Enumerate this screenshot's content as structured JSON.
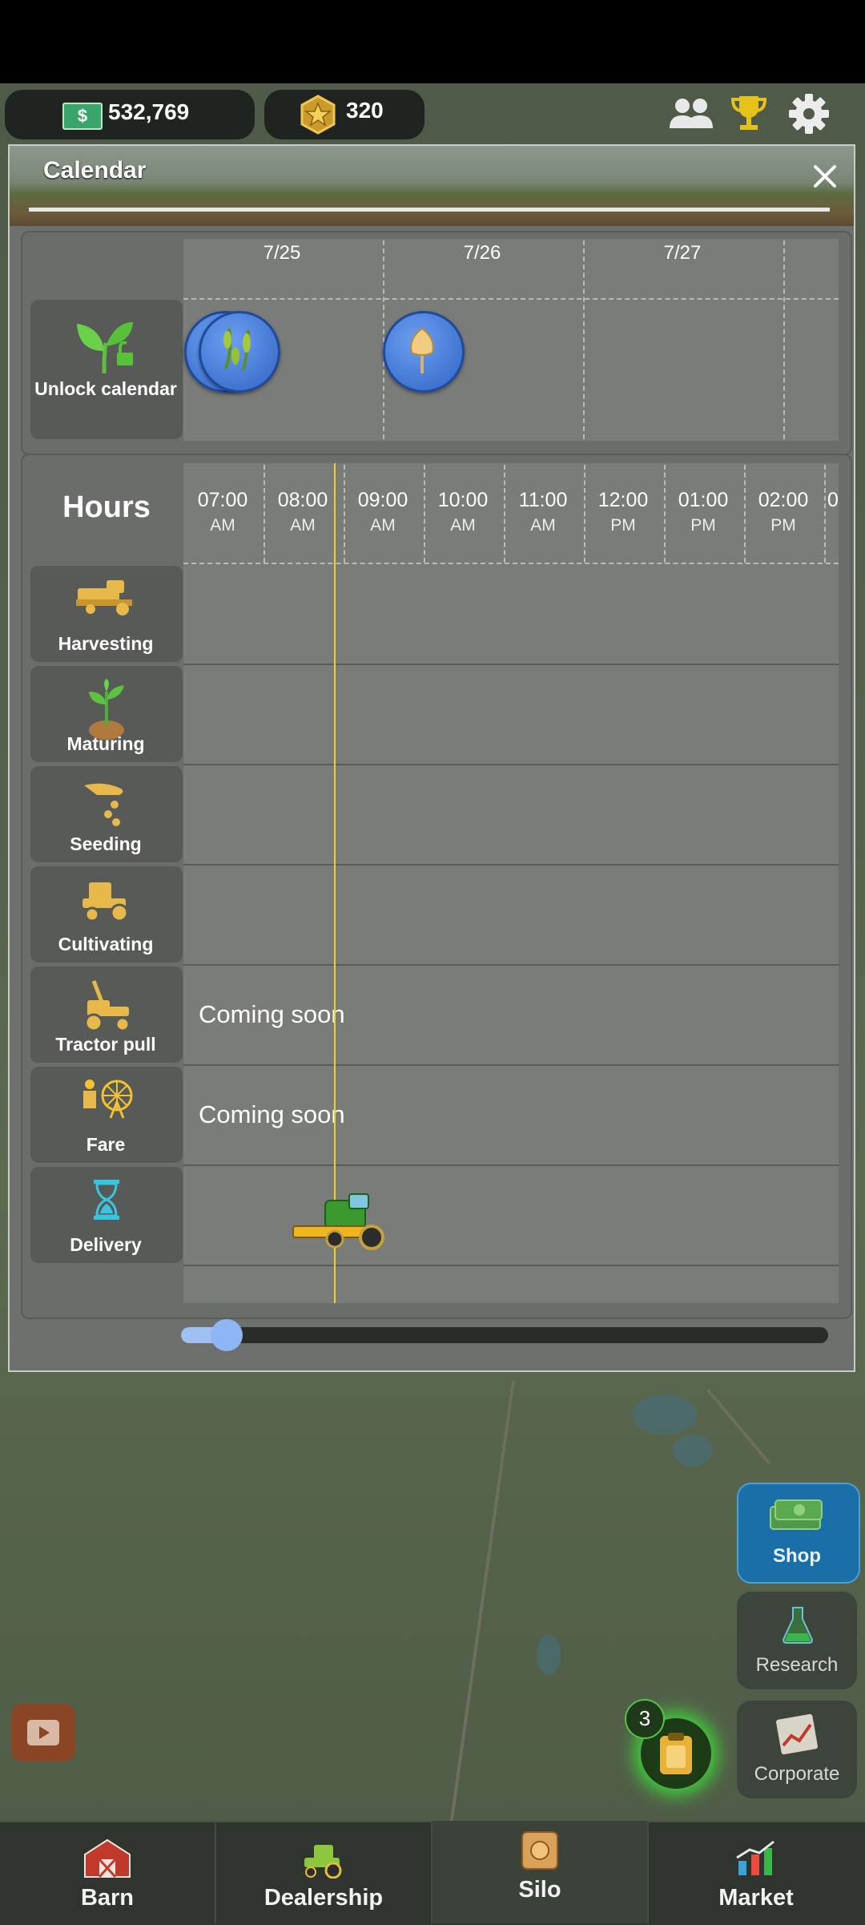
{
  "topbar": {
    "money": "532,769",
    "cash_symbol": "$",
    "stars": "320"
  },
  "calendar": {
    "title": "Calendar",
    "days": [
      "7/25",
      "7/26",
      "7/27"
    ],
    "unlock_label": "Unlock calendar",
    "hours_title": "Hours",
    "hours": [
      {
        "time": "07:00",
        "ampm": "AM"
      },
      {
        "time": "08:00",
        "ampm": "AM"
      },
      {
        "time": "09:00",
        "ampm": "AM"
      },
      {
        "time": "10:00",
        "ampm": "AM"
      },
      {
        "time": "11:00",
        "ampm": "AM"
      },
      {
        "time": "12:00",
        "ampm": "PM"
      },
      {
        "time": "01:00",
        "ampm": "PM"
      },
      {
        "time": "02:00",
        "ampm": "PM"
      }
    ],
    "rows": [
      {
        "label": "Harvesting",
        "icon": "harvester-icon",
        "note": ""
      },
      {
        "label": "Maturing",
        "icon": "sprout-icon",
        "note": ""
      },
      {
        "label": "Seeding",
        "icon": "seeding-hand-icon",
        "note": ""
      },
      {
        "label": "Cultivating",
        "icon": "tractor-icon",
        "note": ""
      },
      {
        "label": "Tractor pull",
        "icon": "tractor-pull-icon",
        "note": "Coming soon"
      },
      {
        "label": "Fare",
        "icon": "fair-icon",
        "note": "Coming soon"
      },
      {
        "label": "Delivery",
        "icon": "hourglass-icon",
        "note": ""
      }
    ],
    "timeline_position": 0.07
  },
  "side_buttons": {
    "shop": "Shop",
    "research": "Research",
    "corporate": "Corporate"
  },
  "clipboard_badge": "3",
  "nav": {
    "barn": "Barn",
    "dealership": "Dealership",
    "silo": "Silo",
    "market": "Market"
  },
  "colors": {
    "accent_blue": "#8fb6f4",
    "now_line": "#f4d11c",
    "icon_gold": "#e7b84a",
    "shop_blue": "#1b6fa8"
  }
}
